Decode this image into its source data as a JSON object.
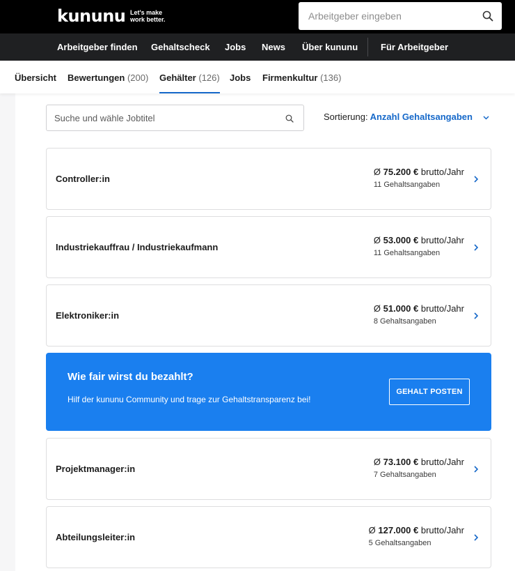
{
  "header": {
    "logo": "kununu",
    "tagline_line1": "Let's make",
    "tagline_line2": "work better.",
    "search_placeholder": "Arbeitgeber eingeben",
    "search_icon": "search-icon"
  },
  "main_nav": {
    "items": [
      {
        "label": "Arbeitgeber finden"
      },
      {
        "label": "Gehaltscheck"
      },
      {
        "label": "Jobs"
      },
      {
        "label": "News"
      },
      {
        "label": "Über kununu"
      },
      {
        "label": "Für Arbeitgeber"
      }
    ]
  },
  "sub_nav": {
    "tabs": [
      {
        "label": "Übersicht",
        "count": ""
      },
      {
        "label": "Bewertungen",
        "count": "(200)"
      },
      {
        "label": "Gehälter",
        "count": "(126)",
        "active": true
      },
      {
        "label": "Jobs",
        "count": ""
      },
      {
        "label": "Firmenkultur",
        "count": "(136)"
      }
    ]
  },
  "filters": {
    "job_search_placeholder": "Suche und wähle Jobtitel",
    "sort_label": "Sortierung:",
    "sort_value": "Anzahl Gehaltsangaben"
  },
  "jobs": [
    {
      "title": "Controller:in",
      "prefix": "Ø",
      "amount": "75.200 €",
      "unit": "brutto/Jahr",
      "count": "11 Gehaltsangaben"
    },
    {
      "title": "Industriekauffrau / Industriekaufmann",
      "prefix": "Ø",
      "amount": "53.000 €",
      "unit": "brutto/Jahr",
      "count": "11 Gehaltsangaben"
    },
    {
      "title": "Elektroniker:in",
      "prefix": "Ø",
      "amount": "51.000 €",
      "unit": "brutto/Jahr",
      "count": "8 Gehaltsangaben"
    },
    {
      "title": "Projektmanager:in",
      "prefix": "Ø",
      "amount": "73.100 €",
      "unit": "brutto/Jahr",
      "count": "7 Gehaltsangaben"
    },
    {
      "title": "Abteilungsleiter:in",
      "prefix": "Ø",
      "amount": "127.000 €",
      "unit": "brutto/Jahr",
      "count": "5 Gehaltsangaben"
    }
  ],
  "promo": {
    "title": "Wie fair wirst du bezahlt?",
    "text": "Hilf der kununu Community und trage zur Gehaltstransparenz bei!",
    "button": "GEHALT POSTEN"
  },
  "colors": {
    "brand_black": "#000000",
    "nav_bg": "#1f2022",
    "accent_blue": "#1568c9",
    "promo_blue": "#1a7fef"
  }
}
